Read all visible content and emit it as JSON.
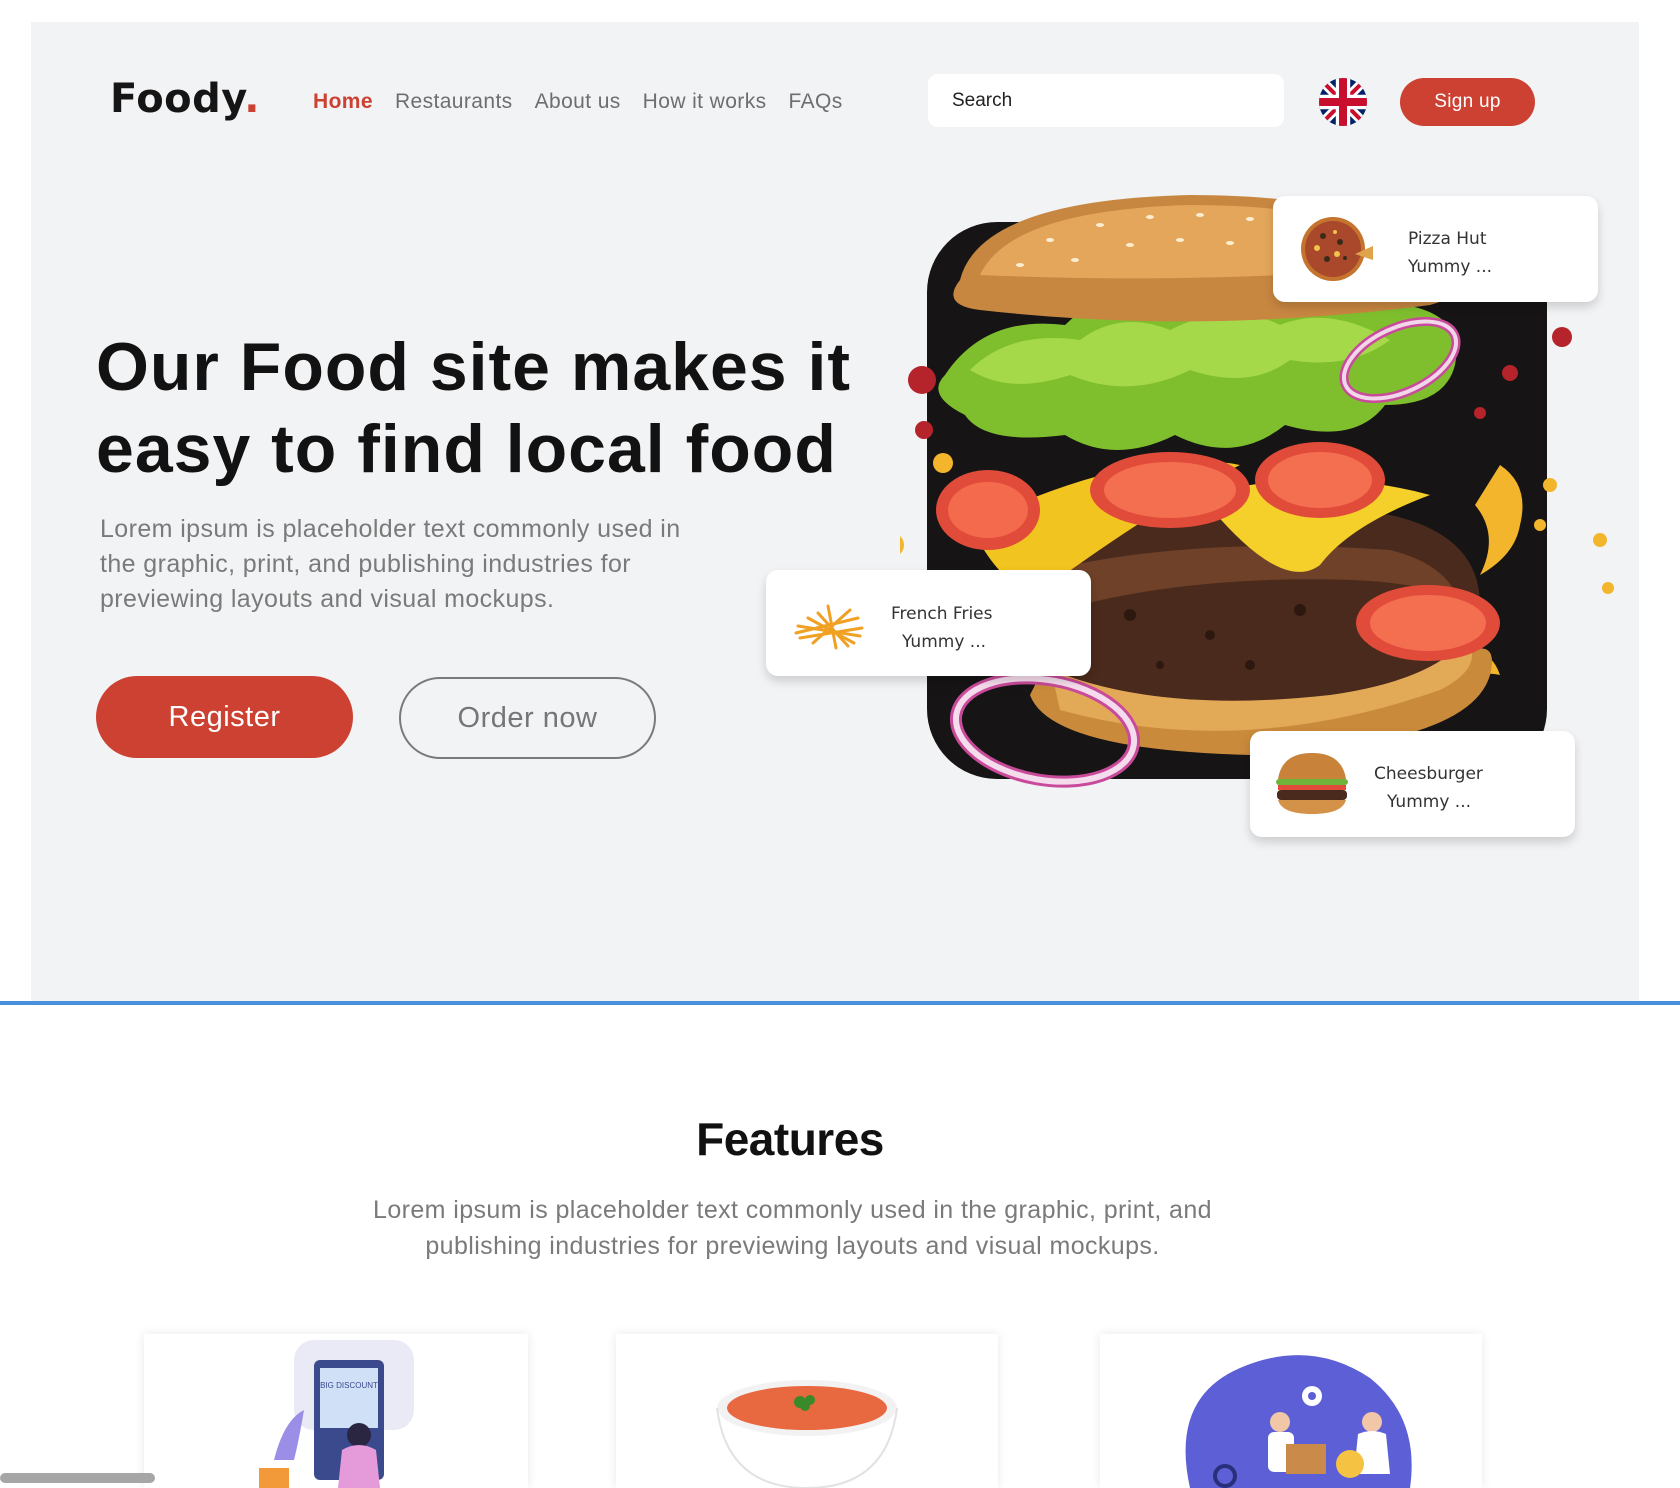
{
  "header": {
    "logo_text": "Foody",
    "logo_dot": ".",
    "nav": [
      {
        "label": "Home",
        "active": true
      },
      {
        "label": "Restaurants",
        "active": false
      },
      {
        "label": "About us",
        "active": false
      },
      {
        "label": "How it works",
        "active": false
      },
      {
        "label": "FAQs",
        "active": false
      }
    ],
    "search_placeholder": "Search",
    "language_icon": "uk-flag-icon",
    "signup_label": "Sign up"
  },
  "hero": {
    "title_line1": "Our Food site makes it",
    "title_line2": "easy to find local food",
    "description": "Lorem ipsum is placeholder text commonly used in the graphic, print, and publishing industries for previewing layouts and visual mockups.",
    "register_label": "Register",
    "order_label": "Order now",
    "cards": [
      {
        "name": "Pizza Hut",
        "subtitle": "Yummy ..."
      },
      {
        "name": "French Fries",
        "subtitle": "Yummy ..."
      },
      {
        "name": "Cheesburger",
        "subtitle": "Yummy ..."
      }
    ]
  },
  "features": {
    "title": "Features",
    "description": "Lorem ipsum is placeholder text commonly used in the graphic, print, and publishing industries for previewing layouts and visual mockups."
  },
  "colors": {
    "accent": "#cc4132",
    "hero_bg": "#f2f3f5",
    "divider": "#4a8fdc"
  }
}
